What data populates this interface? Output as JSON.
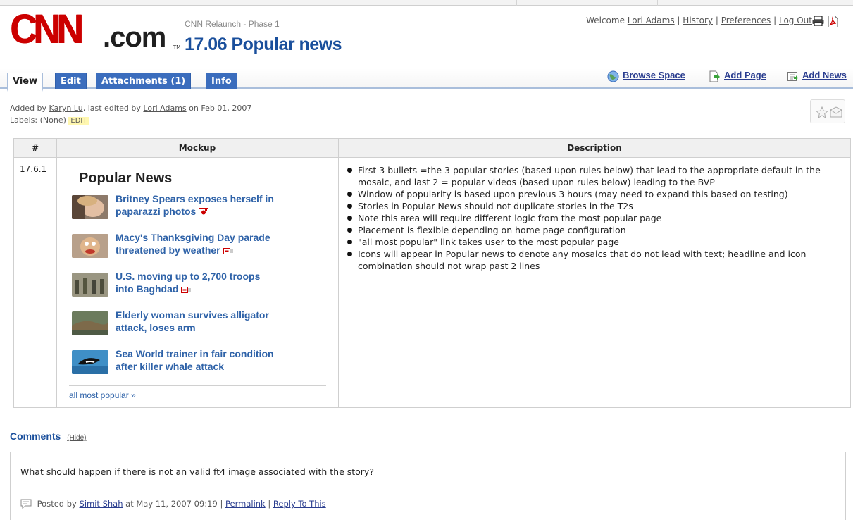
{
  "logo": {
    "cnn": "CNN",
    "com": ".com",
    "tm": "TM"
  },
  "header": {
    "space_name": "CNN Relaunch - Phase 1",
    "page_title": "17.06 Popular news"
  },
  "user_nav": {
    "welcome": "Welcome",
    "user": "Lori Adams",
    "history": "History",
    "preferences": "Preferences",
    "logout": "Log Out",
    "sep": "|"
  },
  "tabs": [
    {
      "label": "View"
    },
    {
      "label": "Edit"
    },
    {
      "label": "Attachments (1)"
    },
    {
      "label": "Info"
    }
  ],
  "actions": {
    "browse_space": "Browse Space",
    "add_page": "Add Page",
    "add_news": "Add News"
  },
  "meta": {
    "added_by_prefix": "Added by",
    "added_by": "Karyn Lu",
    "edited_by_prefix": ", last edited by",
    "edited_by": "Lori Adams",
    "date": "on Feb 01, 2007",
    "labels_prefix": "Labels:",
    "labels_value": "(None)",
    "labels_edit": "EDIT"
  },
  "table": {
    "headers": [
      "#",
      "Mockup",
      "Description"
    ],
    "row_number": "17.6.1",
    "mockup": {
      "title": "Popular News",
      "stories": [
        {
          "line1": "Britney Spears exposes herself in",
          "line2": "paparazzi photos",
          "media": "camera-icon"
        },
        {
          "line1": "Macy's Thanksgiving Day parade",
          "line2": "threatened by weather",
          "media": "video-icon"
        },
        {
          "line1": "U.S. moving up to 2,700 troops",
          "line2": "into Baghdad",
          "media": "video-icon"
        },
        {
          "line1": "Elderly woman survives alligator",
          "line2": "attack, loses arm",
          "media": ""
        },
        {
          "line1": "Sea World trainer in fair condition",
          "line2": "after killer whale attack",
          "media": ""
        }
      ],
      "more_link": "all most popular »"
    },
    "description": [
      "First 3 bullets =the 3 popular stories (based upon rules below) that lead to the appropriate default in the mosaic, and last 2 = popular videos (based upon rules below) leading to the BVP",
      "Window of popularity is based upon previous 3 hours (may need to expand this based on testing)",
      "Stories in Popular News should not duplicate stories in the T2s",
      "Note this area will require different logic from the most popular page",
      "Placement is flexible depending on home page configuration",
      "\"all most popular\" link takes user to the most popular page",
      "Icons will appear in Popular news to denote any mosaics that do not lead with text; headline and icon combination should not wrap past 2 lines"
    ]
  },
  "comments": {
    "title": "Comments",
    "hide": "(Hide)",
    "items": [
      {
        "text": "What should happen if there is not an valid ft4 image associated with the story?",
        "posted_by_prefix": "Posted by",
        "author": "Simit Shah",
        "timestamp": "at May 11, 2007 09:19",
        "permalink": "Permalink",
        "reply": "Reply To This",
        "sep": "|"
      }
    ]
  },
  "colors": {
    "brand_red": "#cc0000",
    "title_blue": "#1a4f9c",
    "tab_blue": "#3b6dbd",
    "link_blue": "#2e62a8"
  }
}
